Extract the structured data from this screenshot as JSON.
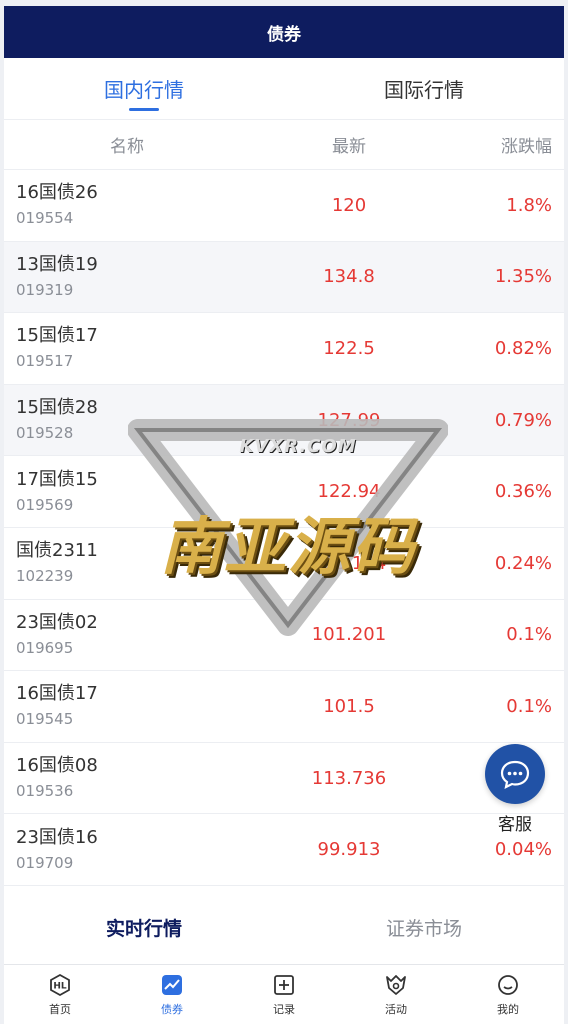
{
  "header": {
    "title": "债券"
  },
  "tabs": [
    {
      "label": "国内行情",
      "active": true
    },
    {
      "label": "国际行情",
      "active": false
    }
  ],
  "columns": {
    "name": "名称",
    "latest": "最新",
    "change": "涨跌幅"
  },
  "rows": [
    {
      "name": "16国债26",
      "code": "019554",
      "price": "120",
      "change": "1.8%"
    },
    {
      "name": "13国债19",
      "code": "019319",
      "price": "134.8",
      "change": "1.35%"
    },
    {
      "name": "15国债17",
      "code": "019517",
      "price": "122.5",
      "change": "0.82%"
    },
    {
      "name": "15国债28",
      "code": "019528",
      "price": "127.99",
      "change": "0.79%"
    },
    {
      "name": "17国债15",
      "code": "019569",
      "price": "122.94",
      "change": "0.36%"
    },
    {
      "name": "国债2311",
      "code": "102239",
      "price": "100.154",
      "change": "0.24%"
    },
    {
      "name": "23国债02",
      "code": "019695",
      "price": "101.201",
      "change": "0.1%"
    },
    {
      "name": "16国债17",
      "code": "019545",
      "price": "101.5",
      "change": "0.1%"
    },
    {
      "name": "16国债08",
      "code": "019536",
      "price": "113.736",
      "change": ""
    },
    {
      "name": "23国债16",
      "code": "019709",
      "price": "99.913",
      "change": "0.04%"
    }
  ],
  "bottom_tabs": [
    {
      "label": "实时行情",
      "active": true
    },
    {
      "label": "证券市场",
      "active": false
    }
  ],
  "customer_service": {
    "label": "客服",
    "icon": "chat-icon"
  },
  "nav": [
    {
      "label": "首页",
      "icon": "home-logo-icon",
      "active": false
    },
    {
      "label": "债券",
      "icon": "trend-chart-icon",
      "active": true
    },
    {
      "label": "记录",
      "icon": "plus-square-icon",
      "active": false
    },
    {
      "label": "活动",
      "icon": "badge-icon",
      "active": false
    },
    {
      "label": "我的",
      "icon": "user-chat-icon",
      "active": false
    }
  ],
  "watermark": {
    "text": "南亚源码",
    "url": "KVXR.COM"
  },
  "colors": {
    "header_bg": "#0e1c5f",
    "accent": "#2e6fe0",
    "up": "#e53935",
    "cs_bg": "#2152a6"
  }
}
